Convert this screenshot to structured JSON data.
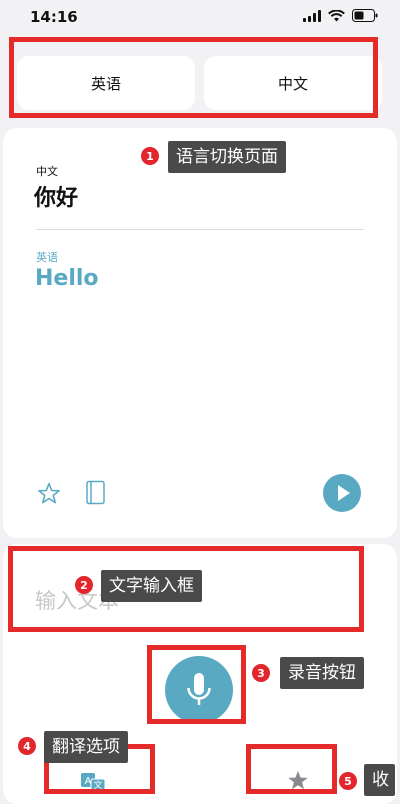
{
  "status_bar": {
    "time": "14:16"
  },
  "language_tabs": {
    "left": "英语",
    "right": "中文"
  },
  "card": {
    "source_lang": "中文",
    "source_text": "你好",
    "target_lang": "英语",
    "target_text": "Hello"
  },
  "input": {
    "placeholder": "输入文本"
  },
  "annotations": [
    {
      "num": "1",
      "text": "语言切换页面"
    },
    {
      "num": "2",
      "text": "文字输入框"
    },
    {
      "num": "3",
      "text": "录音按钮"
    },
    {
      "num": "4",
      "text": "翻译选项"
    },
    {
      "num": "5",
      "text": "收"
    }
  ],
  "colors": {
    "accent": "#5aa9c3",
    "annotation_red": "#e52a2a",
    "annotation_bg": "#4a4a4a"
  }
}
